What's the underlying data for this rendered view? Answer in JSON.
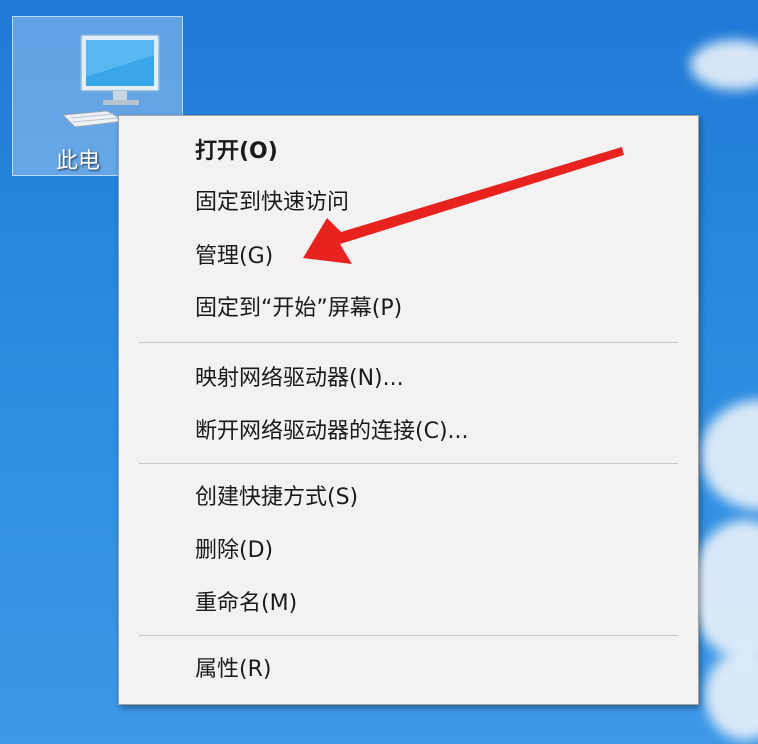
{
  "desktop": {
    "icon": {
      "name": "monitor-icon",
      "label": "此电"
    }
  },
  "context_menu": {
    "items": [
      {
        "label": "打开(O)",
        "bold": true
      },
      {
        "label": "固定到快速访问"
      },
      {
        "label": "管理(G)"
      },
      {
        "label": "固定到“开始”屏幕(P)"
      },
      {
        "label": "映射网络驱动器(N)..."
      },
      {
        "label": "断开网络驱动器的连接(C)..."
      },
      {
        "label": "创建快捷方式(S)"
      },
      {
        "label": "删除(D)"
      },
      {
        "label": "重命名(M)"
      },
      {
        "label": "属性(R)"
      }
    ]
  },
  "annotation": {
    "arrow_color": "#e8231f",
    "points_to": "管理(G)"
  },
  "colors": {
    "desktop_background": "#2b8be0",
    "menu_background": "#f2f2f2",
    "menu_border": "#a0a0a0",
    "separator": "#c8c8c8"
  }
}
